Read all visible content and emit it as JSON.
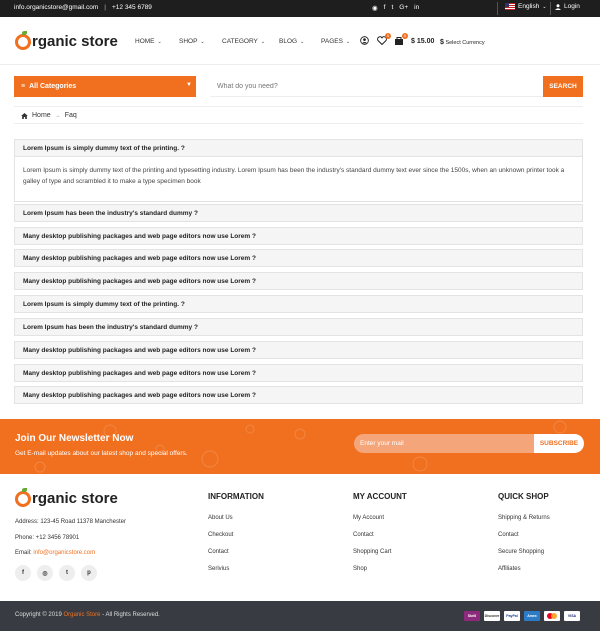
{
  "topbar": {
    "email": "info.organicstore@gmail.com",
    "separator": "|",
    "phone": "+12 345 6789",
    "social_icons": [
      "rss-icon",
      "facebook-icon",
      "twitter-icon",
      "google-plus-icon",
      "linkedin-icon"
    ],
    "language": "English",
    "login": "Login"
  },
  "header": {
    "logo_text": "rganic store",
    "nav": [
      {
        "label": "HOME"
      },
      {
        "label": "SHOP"
      },
      {
        "label": "CATEGORY"
      },
      {
        "label": "BLOG"
      },
      {
        "label": "PAGES"
      }
    ],
    "wishlist_count": "0",
    "cart_count": "0",
    "cart_total": "$ 15.00",
    "currency_symbol": "$",
    "currency_label": "Select Currency"
  },
  "search": {
    "category_label": "All Categories",
    "placeholder": "What do you need?",
    "button": "SEARCH"
  },
  "breadcrumb": {
    "home": "Home",
    "separator": "→",
    "current": "Faq"
  },
  "faq": [
    {
      "q": "Lorem Ipsum is simply dummy text of the printing. ?",
      "a": "Lorem Ipsum is simply dummy text of the printing and typesetting industry. Lorem Ipsum has been the industry's standard dummy text ever since the 1500s, when an unknown printer took a galley of type and scrambled it to make a type specimen book"
    },
    {
      "q": "Lorem Ipsum has been the industry's standard dummy ?"
    },
    {
      "q": "Many desktop publishing packages and web page editors now use Lorem ?"
    },
    {
      "q": "Many desktop publishing packages and web page editors now use Lorem ?"
    },
    {
      "q": "Many desktop publishing packages and web page editors now use Lorem ?"
    },
    {
      "q": "Lorem Ipsum is simply dummy text of the printing. ?"
    },
    {
      "q": "Lorem Ipsum has been the industry's standard dummy ?"
    },
    {
      "q": "Many desktop publishing packages and web page editors now use Lorem ?"
    },
    {
      "q": "Many desktop publishing packages and web page editors now use Lorem ?"
    },
    {
      "q": "Many desktop publishing packages and web page editors now use Lorem ?"
    }
  ],
  "newsletter": {
    "title": "Join Our Newsletter Now",
    "subtitle": "Get E-mail updates about our latest shop and special offers.",
    "placeholder": "Enter your mail",
    "button": "SUBSCRIBE"
  },
  "footer": {
    "address": "Address: 123-45 Road 11378 Manchester",
    "phone": "Phone: +12 3456 78901",
    "email_label": "Email: ",
    "email": "info@organicstore.com",
    "social_letters": [
      "f",
      "◎",
      "t",
      "p"
    ],
    "columns": [
      {
        "title": "INFORMATION",
        "links": [
          "About Us",
          "Checkout",
          "Contact",
          "Serivius"
        ]
      },
      {
        "title": "MY ACCOUNT",
        "links": [
          "My Account",
          "Contact",
          "Shopping Cart",
          "Shop"
        ]
      },
      {
        "title": "QUICK SHOP",
        "links": [
          "Shipping & Returns",
          "Contact",
          "Secure Shopping",
          "Affiliates"
        ]
      }
    ]
  },
  "bottom": {
    "copyright_prefix": "Copyright © 2019 ",
    "brand": "Organic Store",
    "copyright_suffix": " - All Rights Reserved.",
    "payments": [
      "Skrill",
      "Discover",
      "PayPal",
      "Amex",
      "MasterCard",
      "VISA"
    ]
  },
  "colors": {
    "accent": "#f07020",
    "dark": "#1e1e1e",
    "bottom": "#383c42"
  }
}
